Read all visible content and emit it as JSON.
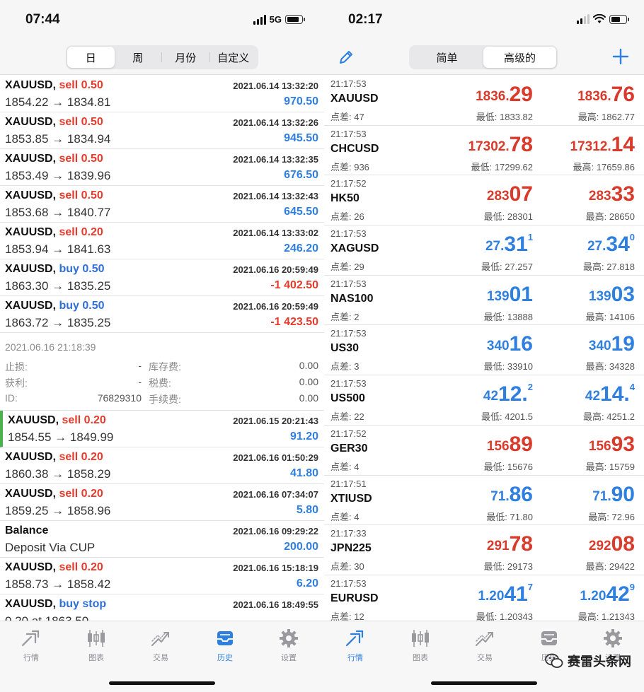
{
  "left": {
    "status": {
      "time": "07:44",
      "network": "5G"
    },
    "segments": [
      "日",
      "周",
      "月份",
      "自定义"
    ],
    "trades_top": [
      {
        "symbol": "XAUUSD,",
        "action": "sell 0.50",
        "kind": "sell",
        "date": "2021.06.14 13:32:20",
        "prices": "1854.22 → 1834.81",
        "profit": "970.50",
        "sign": "pos"
      },
      {
        "symbol": "XAUUSD,",
        "action": "sell 0.50",
        "kind": "sell",
        "date": "2021.06.14 13:32:26",
        "prices": "1853.85 → 1834.94",
        "profit": "945.50",
        "sign": "pos"
      },
      {
        "symbol": "XAUUSD,",
        "action": "sell 0.50",
        "kind": "sell",
        "date": "2021.06.14 13:32:35",
        "prices": "1853.49 → 1839.96",
        "profit": "676.50",
        "sign": "pos"
      },
      {
        "symbol": "XAUUSD,",
        "action": "sell 0.50",
        "kind": "sell",
        "date": "2021.06.14 13:32:43",
        "prices": "1853.68 → 1840.77",
        "profit": "645.50",
        "sign": "pos"
      },
      {
        "symbol": "XAUUSD,",
        "action": "sell 0.20",
        "kind": "sell",
        "date": "2021.06.14 13:33:02",
        "prices": "1853.94 → 1841.63",
        "profit": "246.20",
        "sign": "pos"
      },
      {
        "symbol": "XAUUSD,",
        "action": "buy 0.50",
        "kind": "buy",
        "date": "2021.06.16 20:59:49",
        "prices": "1863.30 → 1835.25",
        "profit": "-1 402.50",
        "sign": "neg"
      },
      {
        "symbol": "XAUUSD,",
        "action": "buy 0.50",
        "kind": "buy",
        "date": "2021.06.16 20:59:49",
        "prices": "1863.72 → 1835.25",
        "profit": "-1 423.50",
        "sign": "neg"
      }
    ],
    "detail": {
      "date": "2021.06.16 21:18:39",
      "rows": [
        {
          "k1": "止损:",
          "v1": "-",
          "k2": "库存费:",
          "v2": "0.00"
        },
        {
          "k1": "获利:",
          "v1": "-",
          "k2": "税费:",
          "v2": "0.00"
        },
        {
          "k1": "ID:",
          "v1": "76829310",
          "k2": "手续费:",
          "v2": "0.00"
        }
      ]
    },
    "trades_bottom": [
      {
        "symbol": "XAUUSD,",
        "action": "sell 0.20",
        "kind": "sell",
        "date": "2021.06.15 20:21:43",
        "prices": "1854.55 → 1849.99",
        "profit": "91.20",
        "sign": "pos",
        "highlight": true
      },
      {
        "symbol": "XAUUSD,",
        "action": "sell 0.20",
        "kind": "sell",
        "date": "2021.06.16 01:50:29",
        "prices": "1860.38 → 1858.29",
        "profit": "41.80",
        "sign": "pos"
      },
      {
        "symbol": "XAUUSD,",
        "action": "sell 0.20",
        "kind": "sell",
        "date": "2021.06.16 07:34:07",
        "prices": "1859.25 → 1858.96",
        "profit": "5.80",
        "sign": "pos"
      },
      {
        "symbol": "Balance",
        "action": "",
        "kind": "none",
        "date": "2021.06.16 09:29:22",
        "prices": "Deposit Via CUP",
        "profit": "200.00",
        "sign": "pos"
      },
      {
        "symbol": "XAUUSD,",
        "action": "sell 0.20",
        "kind": "sell",
        "date": "2021.06.16 15:18:19",
        "prices": "1858.73 → 1858.42",
        "profit": "6.20",
        "sign": "pos"
      },
      {
        "symbol": "XAUUSD,",
        "action": "buy stop",
        "kind": "buy-stop",
        "date": "2021.06.16 18:49:55",
        "prices": "0.20 at 1863.50",
        "profit": "",
        "sign": "pos"
      }
    ],
    "tabs": [
      {
        "label": "行情",
        "icon": "quotes-icon",
        "active": false
      },
      {
        "label": "图表",
        "icon": "chart-icon",
        "active": false
      },
      {
        "label": "交易",
        "icon": "trade-icon",
        "active": false
      },
      {
        "label": "历史",
        "icon": "history-icon",
        "active": true
      },
      {
        "label": "设置",
        "icon": "settings-icon",
        "active": false
      }
    ]
  },
  "right": {
    "status": {
      "time": "02:17"
    },
    "segments": [
      "简单",
      "高级的"
    ],
    "quotes": [
      {
        "time": "21:17:53",
        "symbol": "XAUUSD",
        "spread": "点差: 47",
        "color": "red",
        "bid": {
          "pre": "1836.",
          "big": "29",
          "sup": ""
        },
        "ask": {
          "pre": "1836.",
          "big": "76",
          "sup": ""
        },
        "low": "最低: 1833.82",
        "high": "最高: 1862.77"
      },
      {
        "time": "21:17:53",
        "symbol": "CHCUSD",
        "spread": "点差: 936",
        "color": "red",
        "bid": {
          "pre": "17302.",
          "big": "78",
          "sup": ""
        },
        "ask": {
          "pre": "17312.",
          "big": "14",
          "sup": ""
        },
        "low": "最低: 17299.62",
        "high": "最高: 17659.86"
      },
      {
        "time": "21:17:52",
        "symbol": "HK50",
        "spread": "点差: 26",
        "color": "red",
        "bid": {
          "pre": "283",
          "big": "07",
          "sup": ""
        },
        "ask": {
          "pre": "283",
          "big": "33",
          "sup": ""
        },
        "low": "最低: 28301",
        "high": "最高: 28650"
      },
      {
        "time": "21:17:53",
        "symbol": "XAGUSD",
        "spread": "点差: 29",
        "color": "blue",
        "bid": {
          "pre": "27.",
          "big": "31",
          "sup": "1"
        },
        "ask": {
          "pre": "27.",
          "big": "34",
          "sup": "0"
        },
        "low": "最低: 27.257",
        "high": "最高: 27.818"
      },
      {
        "time": "21:17:53",
        "symbol": "NAS100",
        "spread": "点差: 2",
        "color": "blue",
        "bid": {
          "pre": "139",
          "big": "01",
          "sup": ""
        },
        "ask": {
          "pre": "139",
          "big": "03",
          "sup": ""
        },
        "low": "最低: 13888",
        "high": "最高: 14106"
      },
      {
        "time": "21:17:53",
        "symbol": "US30",
        "spread": "点差: 3",
        "color": "blue",
        "bid": {
          "pre": "340",
          "big": "16",
          "sup": ""
        },
        "ask": {
          "pre": "340",
          "big": "19",
          "sup": ""
        },
        "low": "最低: 33910",
        "high": "最高: 34328"
      },
      {
        "time": "21:17:53",
        "symbol": "US500",
        "spread": "点差: 22",
        "color": "blue",
        "bid": {
          "pre": "42",
          "big": "12.",
          "sup": "2"
        },
        "ask": {
          "pre": "42",
          "big": "14.",
          "sup": "4"
        },
        "low": "最低: 4201.5",
        "high": "最高: 4251.2"
      },
      {
        "time": "21:17:52",
        "symbol": "GER30",
        "spread": "点差: 4",
        "color": "red",
        "bid": {
          "pre": "156",
          "big": "89",
          "sup": ""
        },
        "ask": {
          "pre": "156",
          "big": "93",
          "sup": ""
        },
        "low": "最低: 15676",
        "high": "最高: 15759"
      },
      {
        "time": "21:17:51",
        "symbol": "XTIUSD",
        "spread": "点差: 4",
        "color": "blue",
        "bid": {
          "pre": "71.",
          "big": "86",
          "sup": ""
        },
        "ask": {
          "pre": "71.",
          "big": "90",
          "sup": ""
        },
        "low": "最低: 71.80",
        "high": "最高: 72.96"
      },
      {
        "time": "21:17:33",
        "symbol": "JPN225",
        "spread": "点差: 30",
        "color": "red",
        "bid": {
          "pre": "291",
          "big": "78",
          "sup": ""
        },
        "ask": {
          "pre": "292",
          "big": "08",
          "sup": ""
        },
        "low": "最低: 29173",
        "high": "最高: 29422"
      },
      {
        "time": "21:17:53",
        "symbol": "EURUSD",
        "spread": "点差: 12",
        "color": "blue",
        "bid": {
          "pre": "1.20",
          "big": "41",
          "sup": "7"
        },
        "ask": {
          "pre": "1.20",
          "big": "42",
          "sup": "9"
        },
        "low": "最低: 1.20343",
        "high": "最高: 1.21343"
      }
    ],
    "tabs": [
      {
        "label": "行情",
        "icon": "quotes-icon",
        "active": true
      },
      {
        "label": "图表",
        "icon": "chart-icon",
        "active": false
      },
      {
        "label": "交易",
        "icon": "trade-icon",
        "active": false
      },
      {
        "label": "历史",
        "icon": "history-icon",
        "active": false
      },
      {
        "label": "设置",
        "icon": "settings-icon",
        "active": false
      }
    ],
    "watermark": "赛雷头条网"
  },
  "colors": {
    "sell": "#e53b2c",
    "buy": "#2f6fd6",
    "profit_pos": "#2f7fe0",
    "profit_neg": "#e53b2c",
    "accent": "#2f7fe0"
  }
}
